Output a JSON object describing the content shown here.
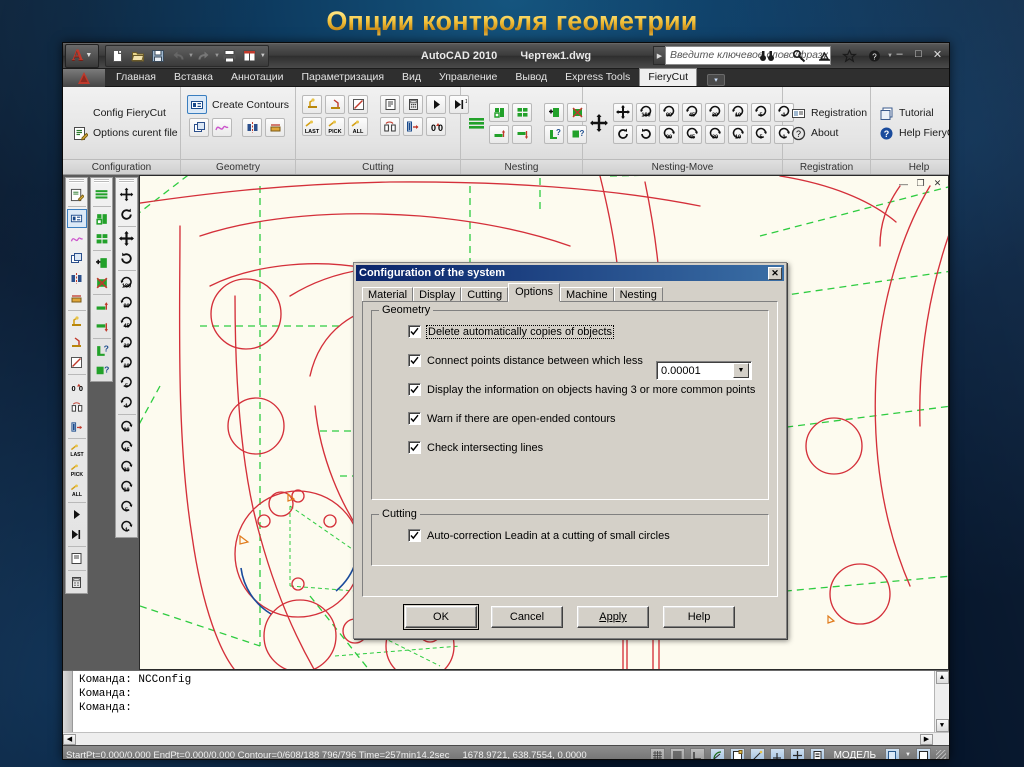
{
  "slide": {
    "title": "Опции контроля геометрии"
  },
  "window": {
    "app_title": "AutoCAD 2010",
    "document_title": "Чертеж1.dwg",
    "search_placeholder": "Введите ключевое слово/фразу",
    "quick_access": [
      {
        "name": "new-icon",
        "glyph": "🗋"
      },
      {
        "name": "open-icon",
        "glyph": "🗁"
      },
      {
        "name": "save-icon",
        "glyph": "🖫"
      },
      {
        "name": "undo-icon",
        "glyph": "↶"
      },
      {
        "name": "redo-icon",
        "glyph": "↷"
      },
      {
        "name": "plot-icon",
        "glyph": "🖶"
      },
      {
        "name": "plot-preview-icon",
        "glyph": "▥"
      }
    ],
    "title_tools": [
      {
        "name": "search-binoculars-icon"
      },
      {
        "name": "communication-center-icon"
      },
      {
        "name": "subscription-icon"
      },
      {
        "name": "favorites-star-icon"
      },
      {
        "name": "help-question-icon"
      }
    ],
    "buttons": {
      "minimize": "–",
      "maximize": "□",
      "close": "✕"
    }
  },
  "ribbon": {
    "tabs": [
      {
        "label": "Главная",
        "active": false
      },
      {
        "label": "Вставка",
        "active": false
      },
      {
        "label": "Аннотации",
        "active": false
      },
      {
        "label": "Параметризация",
        "active": false
      },
      {
        "label": "Вид",
        "active": false
      },
      {
        "label": "Управление",
        "active": false
      },
      {
        "label": "Вывод",
        "active": false
      },
      {
        "label": "Express Tools",
        "active": false
      },
      {
        "label": "FieryCut",
        "active": true
      }
    ],
    "panels": [
      {
        "title": "Configuration",
        "commands": [
          {
            "label": "Config FieryCut",
            "icon": "config-fierycut-icon"
          },
          {
            "label": "Options curent file",
            "icon": "options-current-file-icon"
          }
        ]
      },
      {
        "title": "Geometry",
        "commands": [
          {
            "label": "Create Contours",
            "icon": "create-contours-icon"
          }
        ],
        "icons": [
          "copy-contour-icon",
          "spline-icon",
          "mirror-icon",
          "offset-icon"
        ]
      },
      {
        "title": "Cutting",
        "icons": [
          "leadin-icon",
          "leadout-icon",
          "cut-direction-icon",
          "leadin-last-icon",
          "leadin-pick-icon",
          "leadin-all-icon",
          "report-icon",
          "calc-icon",
          "run-icon",
          "run-step-icon",
          "order-icon",
          "order-pick-icon",
          "order-zero-icon"
        ]
      },
      {
        "title": "Nesting",
        "icons": [
          "nest-sheets-icon",
          "nest-auto-icon",
          "nest-grid-icon",
          "nest-add-icon",
          "nest-delete-icon",
          "nest-align-up-icon",
          "nest-align-down-icon",
          "nest-help-part-icon",
          "nest-help-sheet-icon"
        ]
      },
      {
        "title": "Nesting-Move",
        "move_icon": "move-part-icon",
        "row1": [
          "move-free",
          "180",
          "90",
          "45",
          "30",
          "10",
          "5",
          "1"
        ],
        "row2": [
          "rotate-ccw",
          "rotate-cw",
          "90",
          "45",
          "30",
          "10",
          "5",
          "1"
        ]
      },
      {
        "title": "Registration",
        "commands": [
          {
            "label": "Registration",
            "icon": "registration-icon"
          },
          {
            "label": "About",
            "icon": "about-icon"
          }
        ]
      },
      {
        "title": "Help",
        "commands": [
          {
            "label": "Tutorial",
            "icon": "tutorial-icon"
          },
          {
            "label": "Help FieryCut",
            "icon": "help-fierycut-icon"
          }
        ]
      }
    ]
  },
  "left_toolbars": [
    {
      "name": "fierycut-main-toolbar",
      "buttons": [
        "options-current-file-icon",
        "create-contours-icon",
        "spline-icon",
        "copy-contour-icon",
        "mirror-icon",
        "offset-icon",
        "leadin-icon",
        "leadout-icon",
        "cut-direction-icon",
        "order-icon",
        "order-pick-icon",
        "order-zero-icon",
        "leadin-last-icon",
        "leadin-pick-icon",
        "leadin-all-icon",
        "run-icon",
        "run-step-icon",
        "report-icon",
        "calc-icon"
      ]
    },
    {
      "name": "nesting-toolbar",
      "buttons": [
        "nest-sheets-icon",
        "nest-auto-icon",
        "nest-grid-icon",
        "nest-add-icon",
        "nest-delete-icon",
        "nest-align-up-icon",
        "nest-align-down-icon",
        "nest-help-part-icon",
        "nest-help-sheet-icon"
      ]
    },
    {
      "name": "nesting-move-toolbar",
      "buttons": [
        "move-part-icon",
        "rotate-part-icon",
        "move-free-icon",
        "rotate-cw-icon",
        "rot-180",
        "rot-90",
        "rot-45",
        "rot-30",
        "rot-10",
        "rot-5",
        "rot-1",
        "rot-ccw-90",
        "rot-ccw-45",
        "rot-ccw-30",
        "rot-ccw-10",
        "rot-ccw-5",
        "rot-ccw-1"
      ]
    }
  ],
  "dialog": {
    "title": "Configuration of the system",
    "close_label": "✕",
    "tabs": [
      {
        "label": "Material",
        "active": false
      },
      {
        "label": "Display",
        "active": false
      },
      {
        "label": "Cutting",
        "active": false
      },
      {
        "label": "Options",
        "active": true
      },
      {
        "label": "Machine",
        "active": false
      },
      {
        "label": "Nesting",
        "active": false
      }
    ],
    "groups": [
      {
        "label": "Geometry",
        "checkboxes": [
          {
            "label": "Delete automatically copies of objects",
            "checked": true,
            "focused": true
          },
          {
            "label": "Connect points distance between which less",
            "checked": true,
            "focused": false
          },
          {
            "label": "Display the information on objects having 3 or more common points",
            "checked": true,
            "focused": false
          },
          {
            "label": "Warn if there are open-ended contours",
            "checked": true,
            "focused": false
          },
          {
            "label": "Check intersecting lines",
            "checked": true,
            "focused": false
          }
        ],
        "combo": {
          "name": "connect-distance-combo",
          "value": "0.00001"
        }
      },
      {
        "label": "Cutting",
        "checkboxes": [
          {
            "label": "Auto-correction Leadin at a cutting of small circles",
            "checked": true,
            "focused": false
          }
        ]
      }
    ],
    "buttons": [
      {
        "label": "OK",
        "default": true
      },
      {
        "label": "Cancel",
        "default": false
      },
      {
        "label": "Apply",
        "default": false,
        "accel": "A"
      },
      {
        "label": "Help",
        "default": false
      }
    ]
  },
  "command_window": {
    "lines": [
      "Команда: NCConfig",
      "Команда:",
      "Команда:"
    ]
  },
  "status_bar": {
    "info": "StartPt=0.000/0.000  EndPt=0.000/0.000  Contour=0/608/188  796/796  Time=257min14.2sec",
    "coords": "1678.9721, 638.7554, 0.0000",
    "model_label": "МОДЕЛЬ",
    "toggles": [
      "grid-display-icon",
      "grid-snap-icon",
      "ortho-icon",
      "polar-icon",
      "osnap-icon",
      "otrack-icon",
      "ucs-icon",
      "dyn-icon",
      "lineweight-icon",
      "quick-properties-icon"
    ]
  },
  "colors": {
    "canvas_bg": "#fdfbef",
    "contour_red": "#d4303a",
    "nesting_green": "#2ecc40",
    "dialog_face": "#d4d0c8",
    "dialog_title": "#0a246a",
    "slide_gold": "#f3c13a"
  }
}
